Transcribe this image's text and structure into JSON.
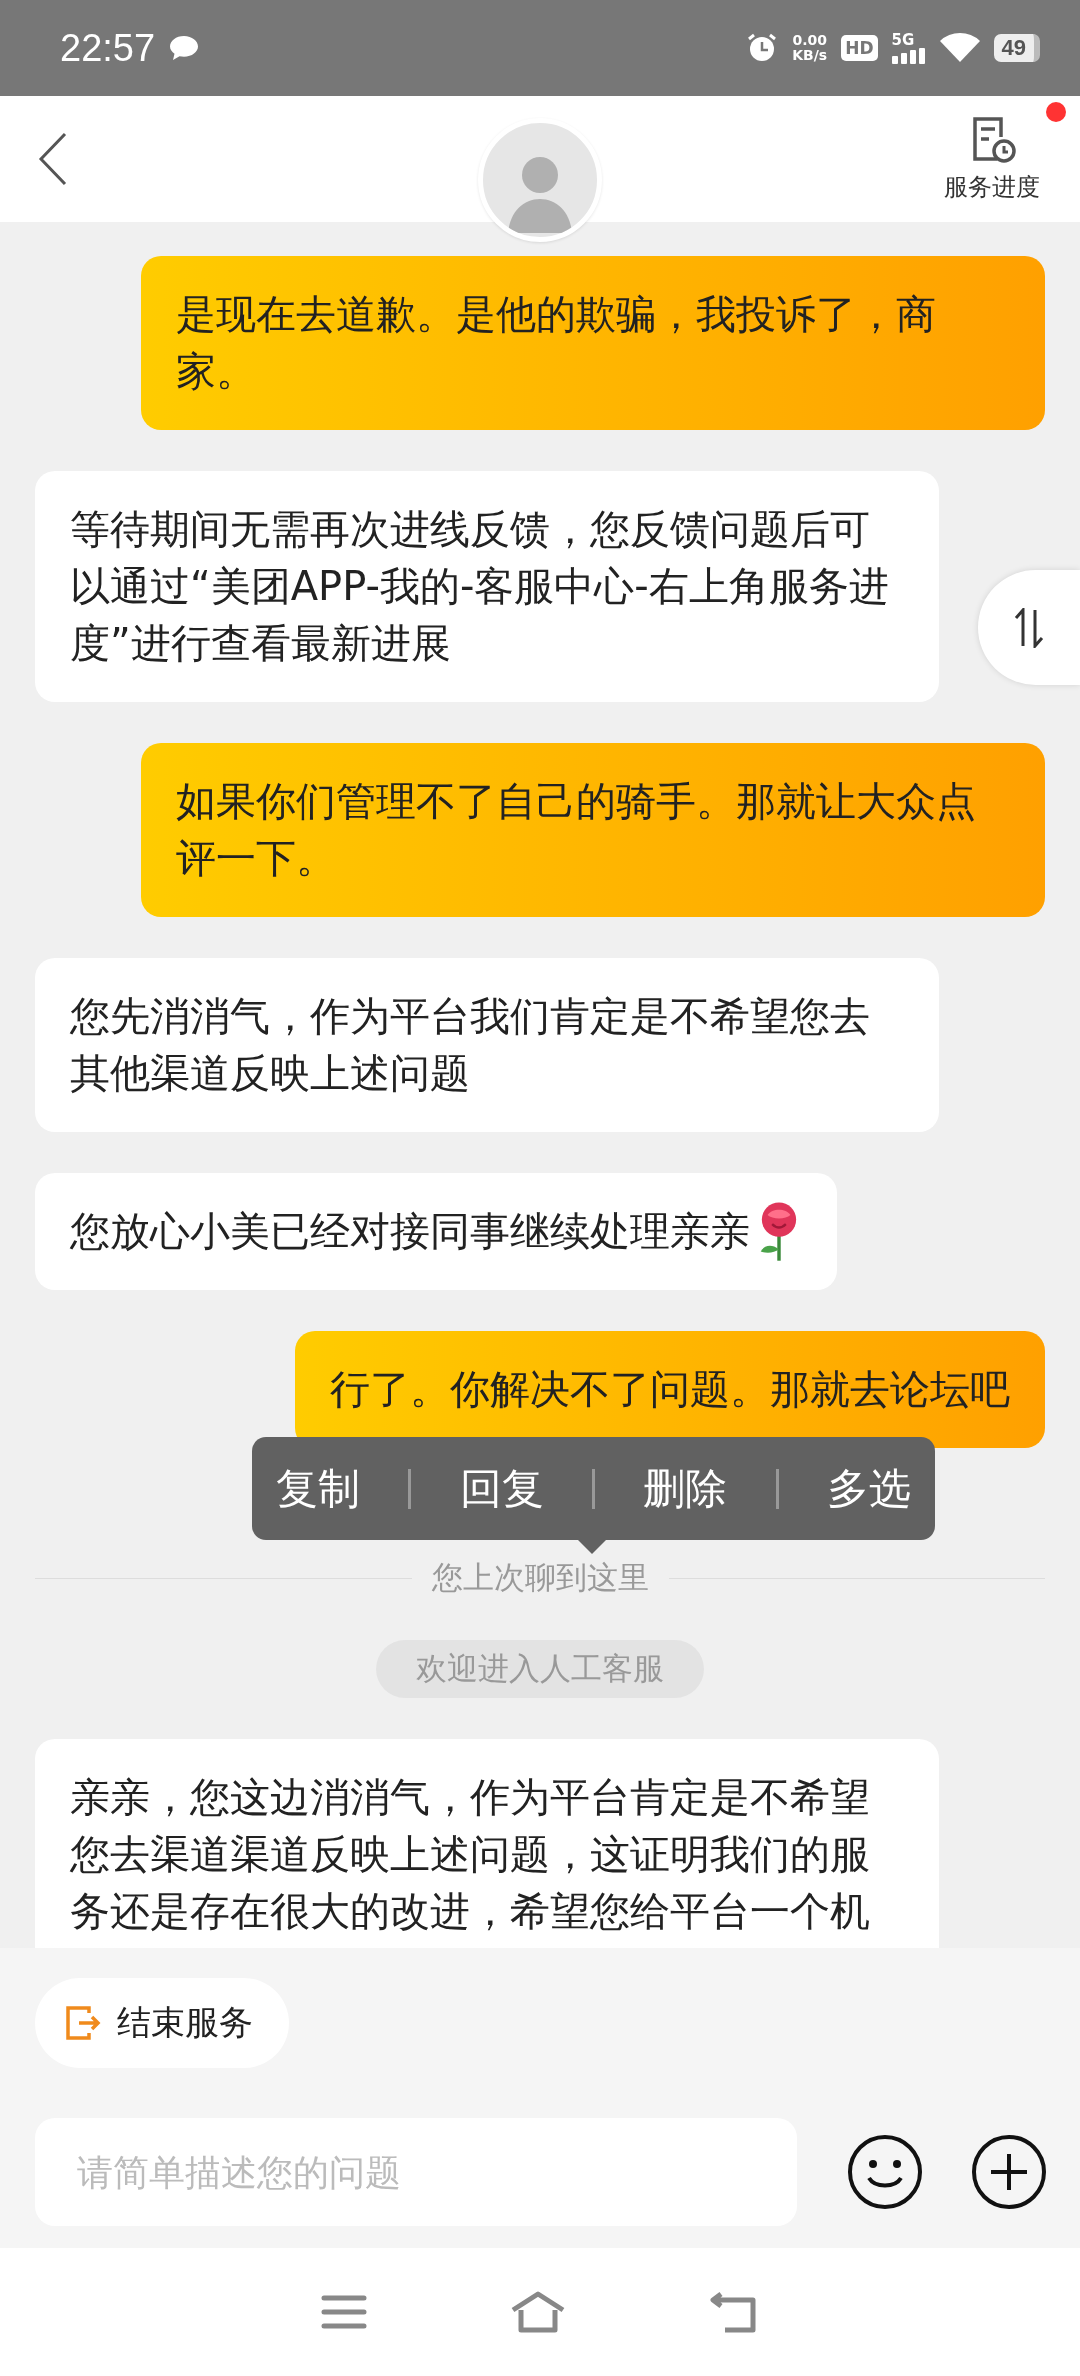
{
  "status_bar": {
    "time": "22:57",
    "net_speed": "0.00",
    "net_unit": "KB/s",
    "hd": "HD",
    "network": "5G",
    "battery": "49"
  },
  "header": {
    "service_progress": {
      "label": "服务进度",
      "badge": true
    }
  },
  "messages": [
    {
      "kind": "user",
      "text": "是现在去道歉。是他的欺骗，我投诉了，商家。"
    },
    {
      "kind": "agent",
      "text": "等待期间无需再次进线反馈，您反馈问题后可以通过“美团APP-我的-客服中心-右上角服务进度”进行查看最新进展"
    },
    {
      "kind": "user",
      "text": "如果你们管理不了自己的骑手。那就让大众点评一下。"
    },
    {
      "kind": "agent",
      "text": "您先消消气，作为平台我们肯定是不希望您去其他渠道反映上述问题"
    },
    {
      "kind": "agent",
      "text": "您放心小美已经对接同事继续处理亲亲",
      "sticker": true
    },
    {
      "kind": "user",
      "text": "行了。你解决不了问题。那就去论坛吧"
    },
    {
      "kind": "divider",
      "text": "您上次聊到这里"
    },
    {
      "kind": "notice",
      "text": "欢迎进入人工客服"
    },
    {
      "kind": "agent",
      "text": "亲亲，您这边消消气，作为平台肯定是不希望您去渠道渠道反映上述问题，这证明我们的服务还是存在很大的改进，希望您给平台一个机"
    }
  ],
  "context_menu": [
    "复制",
    "回复",
    "删除",
    "多选"
  ],
  "end_service": {
    "label": "结束服务"
  },
  "input": {
    "placeholder": "请简单描述您的问题"
  }
}
